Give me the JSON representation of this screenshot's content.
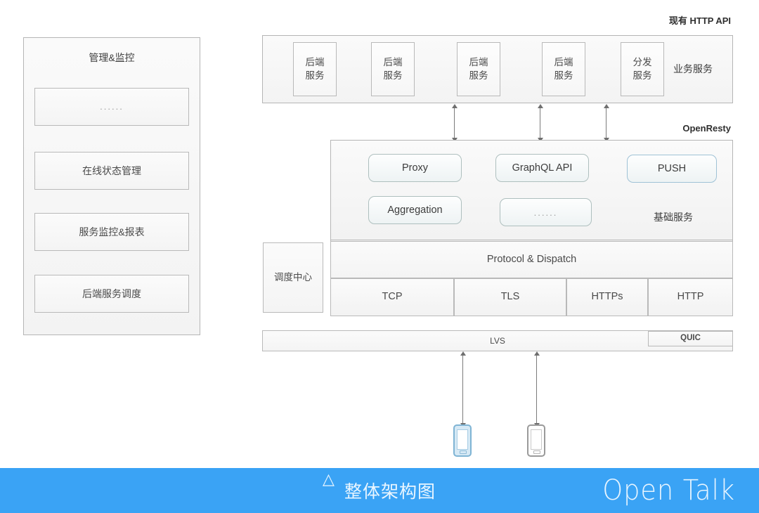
{
  "diagram": {
    "title": "整体架构图",
    "management_panel": {
      "title": "管理&监控",
      "items": [
        {
          "label": "......"
        },
        {
          "label": "在线状态管理"
        },
        {
          "label": "服务监控&报表"
        },
        {
          "label": "后端服务调度"
        }
      ]
    },
    "business_layer": {
      "top_label": "现有 HTTP API",
      "side_label": "业务服务",
      "services": [
        {
          "line1": "后端",
          "line2": "服务"
        },
        {
          "line1": "后端",
          "line2": "服务"
        },
        {
          "line1": "后端",
          "line2": "服务"
        },
        {
          "line1": "后端",
          "line2": "服务"
        },
        {
          "line1": "分发",
          "line2": "服务"
        }
      ]
    },
    "openresty": {
      "top_label": "OpenResty",
      "base_label": "基础服务",
      "modules": [
        {
          "label": "Proxy"
        },
        {
          "label": "GraphQL API"
        },
        {
          "label": "PUSH"
        },
        {
          "label": "Aggregation"
        },
        {
          "label": "......"
        }
      ],
      "dispatch_label": "Protocol & Dispatch",
      "protocols": [
        {
          "label": "TCP"
        },
        {
          "label": "TLS"
        },
        {
          "label": "HTTPs"
        },
        {
          "label": "HTTP"
        }
      ]
    },
    "scheduler": {
      "label": "调度中心"
    },
    "load_balancer": {
      "label": "LVS",
      "quic_label": "QUIC"
    },
    "devices": [
      {
        "name": "phone-primary"
      },
      {
        "name": "phone-secondary"
      }
    ]
  },
  "footer": {
    "caption": "整体架构图",
    "brand": "Open Talk",
    "accent_color": "#3aa3f5"
  }
}
